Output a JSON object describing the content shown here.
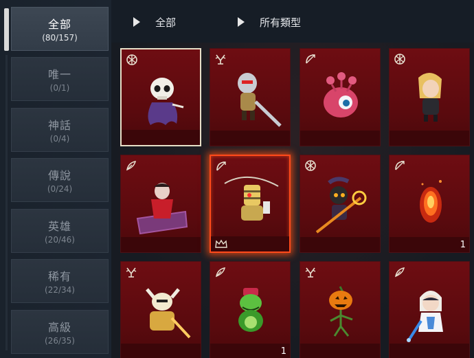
{
  "sidebar": {
    "categories": [
      {
        "name": "全部",
        "count": "(80/157)",
        "active": true
      },
      {
        "name": "唯一",
        "count": "(0/1)"
      },
      {
        "name": "神話",
        "count": "(0/4)"
      },
      {
        "name": "傳說",
        "count": "(0/24)"
      },
      {
        "name": "英雄",
        "count": "(20/46)"
      },
      {
        "name": "稀有",
        "count": "(22/34)"
      },
      {
        "name": "高級",
        "count": "(26/35)"
      }
    ]
  },
  "header": {
    "filter_grade": "全部",
    "filter_type": "所有類型"
  },
  "grid": {
    "cards": [
      {
        "class_icon": "guardian-emblem-icon",
        "figure": "skeleton-ghost"
      },
      {
        "class_icon": "warrior-emblem-icon",
        "figure": "armored-knight"
      },
      {
        "class_icon": "bow-emblem-icon",
        "figure": "pink-eye-monster"
      },
      {
        "class_icon": "guardian-emblem-icon",
        "figure": "blonde-girl"
      },
      {
        "class_icon": "feather-emblem-icon",
        "figure": "vampire-coffin"
      },
      {
        "class_icon": "bow-emblem-icon",
        "figure": "golden-archer",
        "crown": true
      },
      {
        "class_icon": "guardian-emblem-icon",
        "figure": "jester-staff"
      },
      {
        "class_icon": "bow-emblem-icon",
        "figure": "fire-spirit",
        "qty": "1"
      },
      {
        "class_icon": "warrior-emblem-icon",
        "figure": "golden-horned-knight"
      },
      {
        "class_icon": "feather-emblem-icon",
        "figure": "green-frog",
        "qty": "1"
      },
      {
        "class_icon": "warrior-emblem-icon",
        "figure": "pumpkin-head"
      },
      {
        "class_icon": "feather-emblem-icon",
        "figure": "white-mage-girl"
      }
    ]
  },
  "colors": {
    "card_bg": "#6e0d12",
    "selected_fire": "#ff4a1a",
    "selected_white": "#e7dfc8",
    "sidebar_active": "#3d4753"
  }
}
